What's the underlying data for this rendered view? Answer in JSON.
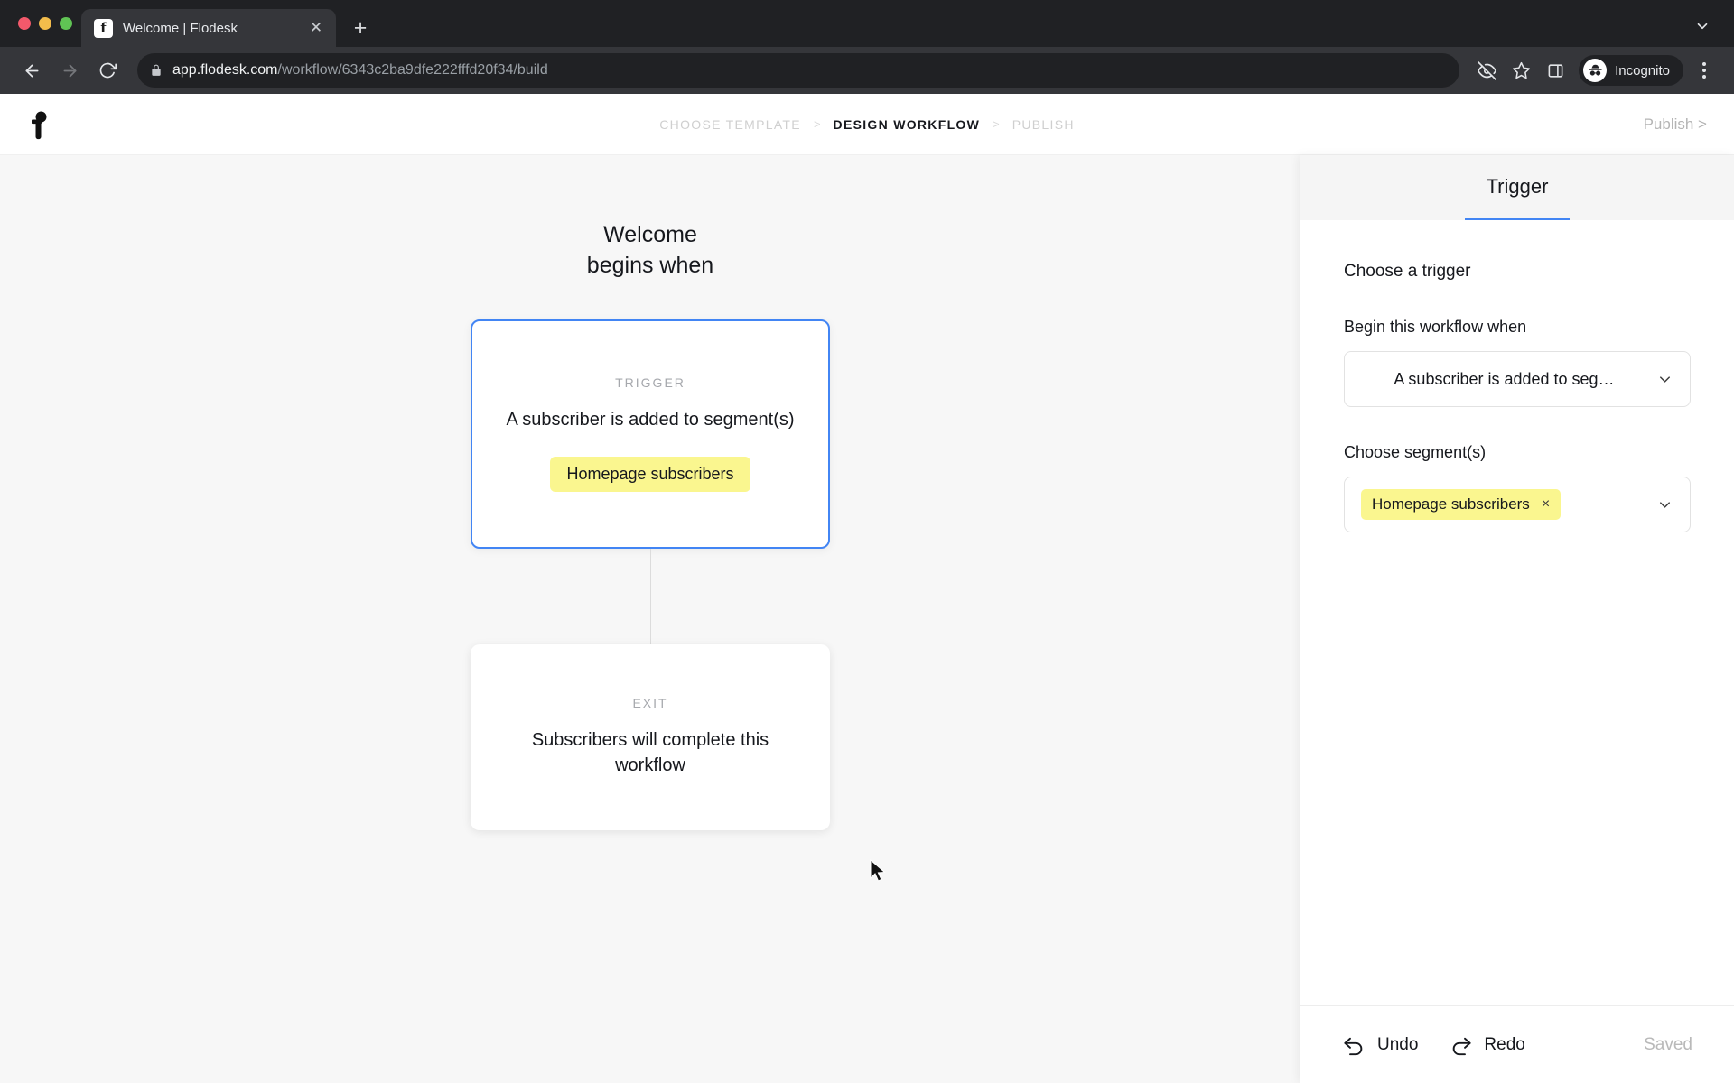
{
  "browser": {
    "tab": {
      "title": "Welcome | Flodesk",
      "favicon_letter": "f",
      "favicon_name": "flodesk-favicon",
      "close_label": "✕"
    },
    "new_tab_label": "+",
    "tab_search_icon": "chevron-down-icon",
    "nav": {
      "back_icon": "back-arrow-icon",
      "forward_icon": "forward-arrow-icon",
      "reload_icon": "reload-icon"
    },
    "omnibox": {
      "lock_icon": "lock-icon",
      "host": "app.flodesk.com",
      "path": "/workflow/6343c2ba9dfe222fffd20f34/build"
    },
    "toolbar_icons": [
      "eye-off-icon",
      "bookmark-star-icon",
      "side-panel-icon"
    ],
    "incognito": {
      "label": "Incognito",
      "icon": "incognito-icon"
    },
    "menu_icon": "kebab-menu-icon"
  },
  "app_header": {
    "logo_name": "flodesk-logo",
    "breadcrumb": [
      {
        "label": "CHOOSE TEMPLATE",
        "active": false
      },
      {
        "label": "DESIGN WORKFLOW",
        "active": true
      },
      {
        "label": "PUBLISH",
        "active": false
      }
    ],
    "separator": ">",
    "publish_link": "Publish >"
  },
  "canvas": {
    "title_line1": "Welcome",
    "title_line2": "begins when",
    "trigger_card": {
      "kicker": "TRIGGER",
      "text": "A subscriber is added to segment(s)",
      "chip": "Homepage subscribers"
    },
    "exit_card": {
      "kicker": "EXIT",
      "text": "Subscribers will complete this workflow"
    },
    "cursor_icon": "mouse-pointer-icon"
  },
  "panel": {
    "tabs": [
      {
        "label": "Trigger",
        "active": true
      }
    ],
    "heading": "Choose a trigger",
    "trigger_field": {
      "label": "Begin this workflow when",
      "value": "A subscriber is added to seg…",
      "chevron_icon": "chevron-down-icon"
    },
    "segment_field": {
      "label": "Choose segment(s)",
      "tag": "Homepage subscribers",
      "tag_remove": "×",
      "chevron_icon": "chevron-down-icon"
    },
    "footer": {
      "undo_label": "Undo",
      "undo_icon": "undo-arrow-icon",
      "redo_label": "Redo",
      "redo_icon": "redo-arrow-icon",
      "status": "Saved"
    }
  },
  "colors": {
    "accent_blue": "#4285f4",
    "chip_yellow": "#faf68f",
    "canvas_bg": "#f7f7f7",
    "chrome_dark": "#202124",
    "chrome_toolbar": "#35363a"
  }
}
